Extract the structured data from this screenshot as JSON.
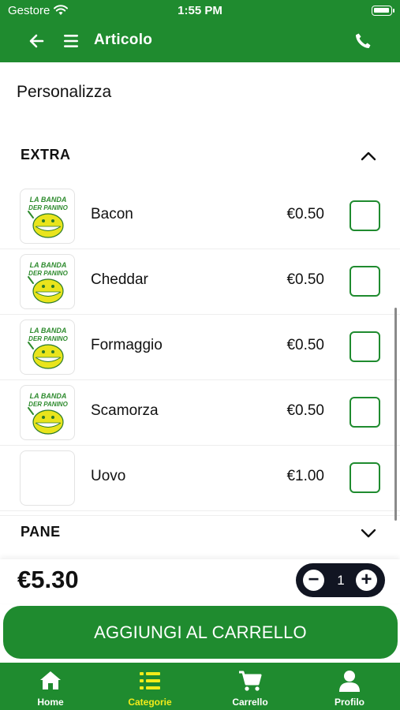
{
  "status_bar": {
    "carrier": "Gestore",
    "time": "1:55 PM"
  },
  "header": {
    "title": "Articolo",
    "icons": [
      "back-arrow-icon",
      "menu-icon",
      "phone-icon"
    ]
  },
  "page": {
    "section_title": "Personalizza"
  },
  "groups": [
    {
      "label": "EXTRA",
      "expanded": true
    },
    {
      "label": "PANE",
      "expanded": false
    }
  ],
  "items": [
    {
      "name": "Bacon",
      "price": "€0.50",
      "has_logo": true,
      "checked": false
    },
    {
      "name": "Cheddar",
      "price": "€0.50",
      "has_logo": true,
      "checked": false
    },
    {
      "name": "Formaggio",
      "price": "€0.50",
      "has_logo": true,
      "checked": false
    },
    {
      "name": "Scamorza",
      "price": "€0.50",
      "has_logo": true,
      "checked": false
    },
    {
      "name": "Uovo",
      "price": "€1.00",
      "has_logo": false,
      "checked": false
    }
  ],
  "logo_text": "LA BANDA DER PANINO",
  "order": {
    "total": "€5.30",
    "quantity": "1",
    "add_button_label": "AGGIUNGI AL CARRELLO"
  },
  "tabs": [
    {
      "label": "Home",
      "icon": "home-icon",
      "active": false
    },
    {
      "label": "Categorie",
      "icon": "list-icon",
      "active": true
    },
    {
      "label": "Carrello",
      "icon": "cart-icon",
      "active": false
    },
    {
      "label": "Profilo",
      "icon": "user-icon",
      "active": false
    }
  ],
  "colors": {
    "brand_green": "#1f8b2f",
    "active_tab": "#f3ec1a",
    "stepper_bg": "#111522"
  }
}
